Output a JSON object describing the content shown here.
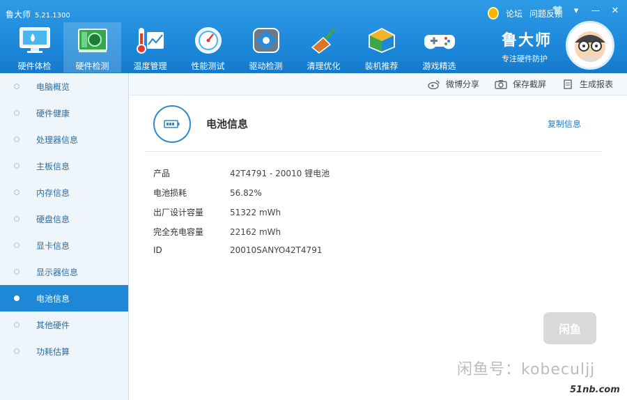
{
  "app": {
    "name": "鲁大师",
    "version": "5.21.1300"
  },
  "top_links": {
    "forum": "论坛",
    "feedback": "问题反馈"
  },
  "nav": [
    {
      "label": "硬件体检",
      "icon": "monitor-icon"
    },
    {
      "label": "硬件检测",
      "icon": "circuit-board-icon",
      "active": true
    },
    {
      "label": "温度管理",
      "icon": "thermometer-icon"
    },
    {
      "label": "性能测试",
      "icon": "speedometer-icon"
    },
    {
      "label": "驱动检测",
      "icon": "gear-icon"
    },
    {
      "label": "清理优化",
      "icon": "broom-icon"
    },
    {
      "label": "装机推荐",
      "icon": "cube-icon"
    },
    {
      "label": "游戏精选",
      "icon": "gamepad-icon"
    }
  ],
  "brand": {
    "name": "鲁大师",
    "slogan": "专注硬件防护"
  },
  "sidebar": [
    {
      "label": "电脑概览"
    },
    {
      "label": "硬件健康"
    },
    {
      "label": "处理器信息"
    },
    {
      "label": "主板信息"
    },
    {
      "label": "内存信息"
    },
    {
      "label": "硬盘信息"
    },
    {
      "label": "显卡信息"
    },
    {
      "label": "显示器信息"
    },
    {
      "label": "电池信息",
      "active": true
    },
    {
      "label": "其他硬件"
    },
    {
      "label": "功耗估算"
    }
  ],
  "toolbar": {
    "share": "微博分享",
    "screenshot": "保存截屏",
    "report": "生成报表"
  },
  "section": {
    "title": "电池信息",
    "copy": "复制信息"
  },
  "battery_info": [
    {
      "key": "产品",
      "value": "42T4791 - 20010 锂电池"
    },
    {
      "key": "电池损耗",
      "value": "56.82%"
    },
    {
      "key": "出厂设计容量",
      "value": "51322 mWh"
    },
    {
      "key": "完全充电容量",
      "value": "22162 mWh"
    },
    {
      "key": "ID",
      "value": "20010SANYO42T4791"
    }
  ],
  "watermark": {
    "badge": "闲鱼",
    "text": "闲鱼号：kobeculjj",
    "site": "51nb.com"
  },
  "colors": {
    "header": "#1b86d8",
    "sidebar_active": "#1f88d6",
    "link": "#2a7ec6"
  }
}
